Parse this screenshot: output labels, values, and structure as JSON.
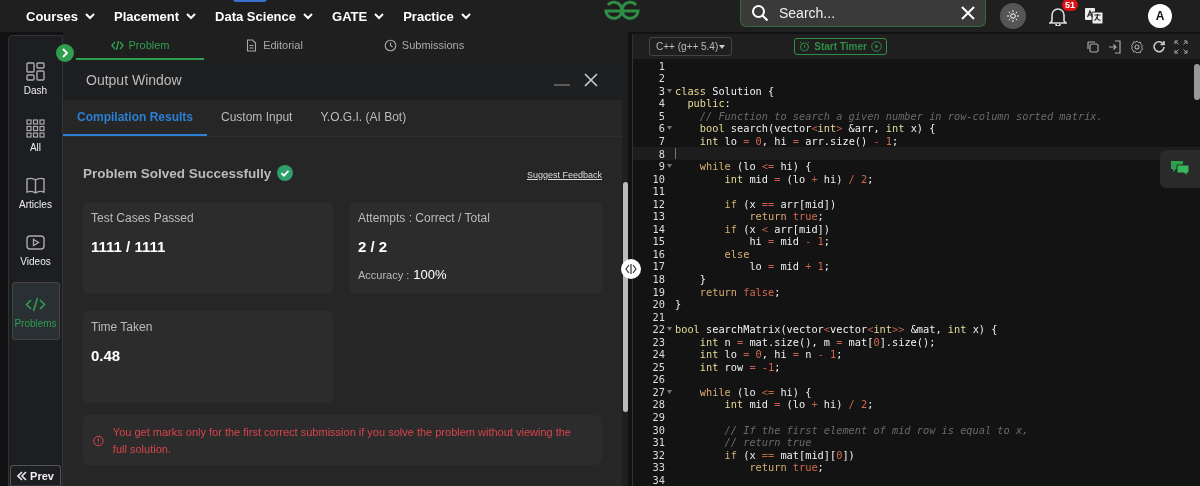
{
  "top_nav": {
    "menus": [
      {
        "label": "Courses"
      },
      {
        "label": "Placement"
      },
      {
        "label": "Data Science",
        "badge_strip": true
      },
      {
        "label": "GATE"
      },
      {
        "label": "Practice"
      }
    ],
    "search": {
      "placeholder": "Search..."
    },
    "notifications": {
      "count": "51"
    },
    "avatar": {
      "initial": "A"
    }
  },
  "sidebar": {
    "items": [
      {
        "label": "Dash",
        "selected": false
      },
      {
        "label": "All",
        "selected": false
      },
      {
        "label": "Articles",
        "selected": false
      },
      {
        "label": "Videos",
        "selected": false
      },
      {
        "label": "Problems",
        "selected": true
      }
    ],
    "prev_button": "Prev"
  },
  "problem_tabs": [
    {
      "label": "Problem",
      "selected": true
    },
    {
      "label": "Editorial",
      "selected": false
    },
    {
      "label": "Submissions",
      "selected": false
    }
  ],
  "output_window": {
    "title": "Output Window",
    "tabs": [
      {
        "label": "Compilation Results",
        "selected": true
      },
      {
        "label": "Custom Input",
        "selected": false
      },
      {
        "label": "Y.O.G.I. (AI Bot)",
        "selected": false
      }
    ],
    "status": "Problem Solved Successfully",
    "success": true,
    "feedback_link": "Suggest Feedback",
    "cards": [
      {
        "label": "Test Cases Passed",
        "value": "1111 / 1111"
      },
      {
        "label": "Attempts : Correct / Total",
        "value": "2 / 2",
        "extra_label": "Accuracy :",
        "extra_value": "100%"
      },
      {
        "label": "Time Taken",
        "value": "0.48"
      }
    ],
    "notice": "You get marks only for the first correct submission if you solve the problem without viewing the full solution."
  },
  "editor": {
    "language": "C++ (g++ 5.4)",
    "timer_button": "Start Timer",
    "lines": [
      {
        "number": "1"
      },
      {
        "number": "2"
      },
      {
        "number": "3",
        "fold": true,
        "tokens": [
          {
            "kind": "type",
            "text": "class"
          },
          {
            "kind": "plain",
            "text": " Solution {"
          }
        ]
      },
      {
        "number": "4",
        "tokens": [
          {
            "kind": "type",
            "text": "  public"
          },
          {
            "kind": "plain",
            "text": ":"
          }
        ]
      },
      {
        "number": "5",
        "tokens": [
          {
            "kind": "comment",
            "text": "    // Function to search a given number in row-column sorted matrix."
          }
        ]
      },
      {
        "number": "6",
        "fold": true,
        "tokens": [
          {
            "kind": "type",
            "text": "    bool"
          },
          {
            "kind": "plain",
            "text": " search(vector"
          },
          {
            "kind": "op",
            "text": "<"
          },
          {
            "kind": "type",
            "text": "int"
          },
          {
            "kind": "op",
            "text": ">"
          },
          {
            "kind": "plain",
            "text": " &arr, "
          },
          {
            "kind": "type",
            "text": "int"
          },
          {
            "kind": "plain",
            "text": " x) {"
          }
        ]
      },
      {
        "number": "7",
        "tokens": [
          {
            "kind": "type",
            "text": "    int"
          },
          {
            "kind": "plain",
            "text": " lo "
          },
          {
            "kind": "op",
            "text": "="
          },
          {
            "kind": "num",
            "text": " 0"
          },
          {
            "kind": "plain",
            "text": ", hi "
          },
          {
            "kind": "op",
            "text": "="
          },
          {
            "kind": "plain",
            "text": " arr.size() "
          },
          {
            "kind": "op",
            "text": "-"
          },
          {
            "kind": "num",
            "text": " 1"
          },
          {
            "kind": "plain",
            "text": ";"
          }
        ]
      },
      {
        "number": "8",
        "current": true
      },
      {
        "number": "9",
        "fold": true,
        "tokens": [
          {
            "kind": "control",
            "text": "    while"
          },
          {
            "kind": "plain",
            "text": " (lo "
          },
          {
            "kind": "op",
            "text": "<="
          },
          {
            "kind": "plain",
            "text": " hi) {"
          }
        ]
      },
      {
        "number": "10",
        "tokens": [
          {
            "kind": "type",
            "text": "        int"
          },
          {
            "kind": "plain",
            "text": " mid "
          },
          {
            "kind": "op",
            "text": "="
          },
          {
            "kind": "plain",
            "text": " (lo "
          },
          {
            "kind": "op",
            "text": "+"
          },
          {
            "kind": "plain",
            "text": " hi) "
          },
          {
            "kind": "op",
            "text": "/"
          },
          {
            "kind": "num",
            "text": " 2"
          },
          {
            "kind": "plain",
            "text": ";"
          }
        ]
      },
      {
        "number": "11"
      },
      {
        "number": "12",
        "tokens": [
          {
            "kind": "control",
            "text": "        if"
          },
          {
            "kind": "plain",
            "text": " (x "
          },
          {
            "kind": "op",
            "text": "=="
          },
          {
            "kind": "plain",
            "text": " arr[mid])"
          }
        ]
      },
      {
        "number": "13",
        "tokens": [
          {
            "kind": "control",
            "text": "            return"
          },
          {
            "kind": "num",
            "text": " true"
          },
          {
            "kind": "plain",
            "text": ";"
          }
        ]
      },
      {
        "number": "14",
        "tokens": [
          {
            "kind": "control",
            "text": "        if"
          },
          {
            "kind": "plain",
            "text": " (x "
          },
          {
            "kind": "op",
            "text": "<"
          },
          {
            "kind": "plain",
            "text": " arr[mid])"
          }
        ]
      },
      {
        "number": "15",
        "tokens": [
          {
            "kind": "plain",
            "text": "            hi "
          },
          {
            "kind": "op",
            "text": "="
          },
          {
            "kind": "plain",
            "text": " mid "
          },
          {
            "kind": "op",
            "text": "-"
          },
          {
            "kind": "num",
            "text": " 1"
          },
          {
            "kind": "plain",
            "text": ";"
          }
        ]
      },
      {
        "number": "16",
        "tokens": [
          {
            "kind": "control",
            "text": "        else"
          }
        ]
      },
      {
        "number": "17",
        "tokens": [
          {
            "kind": "plain",
            "text": "            lo "
          },
          {
            "kind": "op",
            "text": "="
          },
          {
            "kind": "plain",
            "text": " mid "
          },
          {
            "kind": "op",
            "text": "+"
          },
          {
            "kind": "num",
            "text": " 1"
          },
          {
            "kind": "plain",
            "text": ";"
          }
        ]
      },
      {
        "number": "18",
        "tokens": [
          {
            "kind": "plain",
            "text": "    }"
          }
        ]
      },
      {
        "number": "19",
        "tokens": [
          {
            "kind": "control",
            "text": "    return"
          },
          {
            "kind": "num",
            "text": " false"
          },
          {
            "kind": "plain",
            "text": ";"
          }
        ]
      },
      {
        "number": "20",
        "tokens": [
          {
            "kind": "plain",
            "text": "}"
          }
        ]
      },
      {
        "number": "21"
      },
      {
        "number": "22",
        "fold": true,
        "tokens": [
          {
            "kind": "type",
            "text": "bool"
          },
          {
            "kind": "plain",
            "text": " searchMatrix(vector"
          },
          {
            "kind": "op",
            "text": "<"
          },
          {
            "kind": "plain",
            "text": "vector"
          },
          {
            "kind": "op",
            "text": "<"
          },
          {
            "kind": "type",
            "text": "int"
          },
          {
            "kind": "op",
            "text": ">>"
          },
          {
            "kind": "plain",
            "text": " &mat, "
          },
          {
            "kind": "type",
            "text": "int"
          },
          {
            "kind": "plain",
            "text": " x) {"
          }
        ]
      },
      {
        "number": "23",
        "tokens": [
          {
            "kind": "type",
            "text": "    int"
          },
          {
            "kind": "plain",
            "text": " n "
          },
          {
            "kind": "op",
            "text": "="
          },
          {
            "kind": "plain",
            "text": " mat.size(), m "
          },
          {
            "kind": "op",
            "text": "="
          },
          {
            "kind": "plain",
            "text": " mat["
          },
          {
            "kind": "num",
            "text": "0"
          },
          {
            "kind": "plain",
            "text": "].size();"
          }
        ]
      },
      {
        "number": "24",
        "tokens": [
          {
            "kind": "type",
            "text": "    int"
          },
          {
            "kind": "plain",
            "text": " lo "
          },
          {
            "kind": "op",
            "text": "="
          },
          {
            "kind": "num",
            "text": " 0"
          },
          {
            "kind": "plain",
            "text": ", hi "
          },
          {
            "kind": "op",
            "text": "="
          },
          {
            "kind": "plain",
            "text": " n "
          },
          {
            "kind": "op",
            "text": "-"
          },
          {
            "kind": "num",
            "text": " 1"
          },
          {
            "kind": "plain",
            "text": ";"
          }
        ]
      },
      {
        "number": "25",
        "tokens": [
          {
            "kind": "type",
            "text": "    int"
          },
          {
            "kind": "plain",
            "text": " row "
          },
          {
            "kind": "op",
            "text": "="
          },
          {
            "kind": "num",
            "text": " -1"
          },
          {
            "kind": "plain",
            "text": ";"
          }
        ]
      },
      {
        "number": "26"
      },
      {
        "number": "27",
        "fold": true,
        "tokens": [
          {
            "kind": "control",
            "text": "    while"
          },
          {
            "kind": "plain",
            "text": " (lo "
          },
          {
            "kind": "op",
            "text": "<="
          },
          {
            "kind": "plain",
            "text": " hi) {"
          }
        ]
      },
      {
        "number": "28",
        "tokens": [
          {
            "kind": "type",
            "text": "        int"
          },
          {
            "kind": "plain",
            "text": " mid "
          },
          {
            "kind": "op",
            "text": "="
          },
          {
            "kind": "plain",
            "text": " (lo "
          },
          {
            "kind": "op",
            "text": "+"
          },
          {
            "kind": "plain",
            "text": " hi) "
          },
          {
            "kind": "op",
            "text": "/"
          },
          {
            "kind": "num",
            "text": " 2"
          },
          {
            "kind": "plain",
            "text": ";"
          }
        ]
      },
      {
        "number": "29"
      },
      {
        "number": "30",
        "tokens": [
          {
            "kind": "comment",
            "text": "        // If the first element of mid row is equal to x,"
          }
        ]
      },
      {
        "number": "31",
        "tokens": [
          {
            "kind": "comment",
            "text": "        // return true"
          }
        ]
      },
      {
        "number": "32",
        "tokens": [
          {
            "kind": "control",
            "text": "        if"
          },
          {
            "kind": "plain",
            "text": " (x "
          },
          {
            "kind": "op",
            "text": "=="
          },
          {
            "kind": "plain",
            "text": " mat[mid]["
          },
          {
            "kind": "num",
            "text": "0"
          },
          {
            "kind": "plain",
            "text": "])"
          }
        ]
      },
      {
        "number": "33",
        "tokens": [
          {
            "kind": "control",
            "text": "            return"
          },
          {
            "kind": "num",
            "text": " true"
          },
          {
            "kind": "plain",
            "text": ";"
          }
        ]
      },
      {
        "number": "34"
      }
    ]
  }
}
